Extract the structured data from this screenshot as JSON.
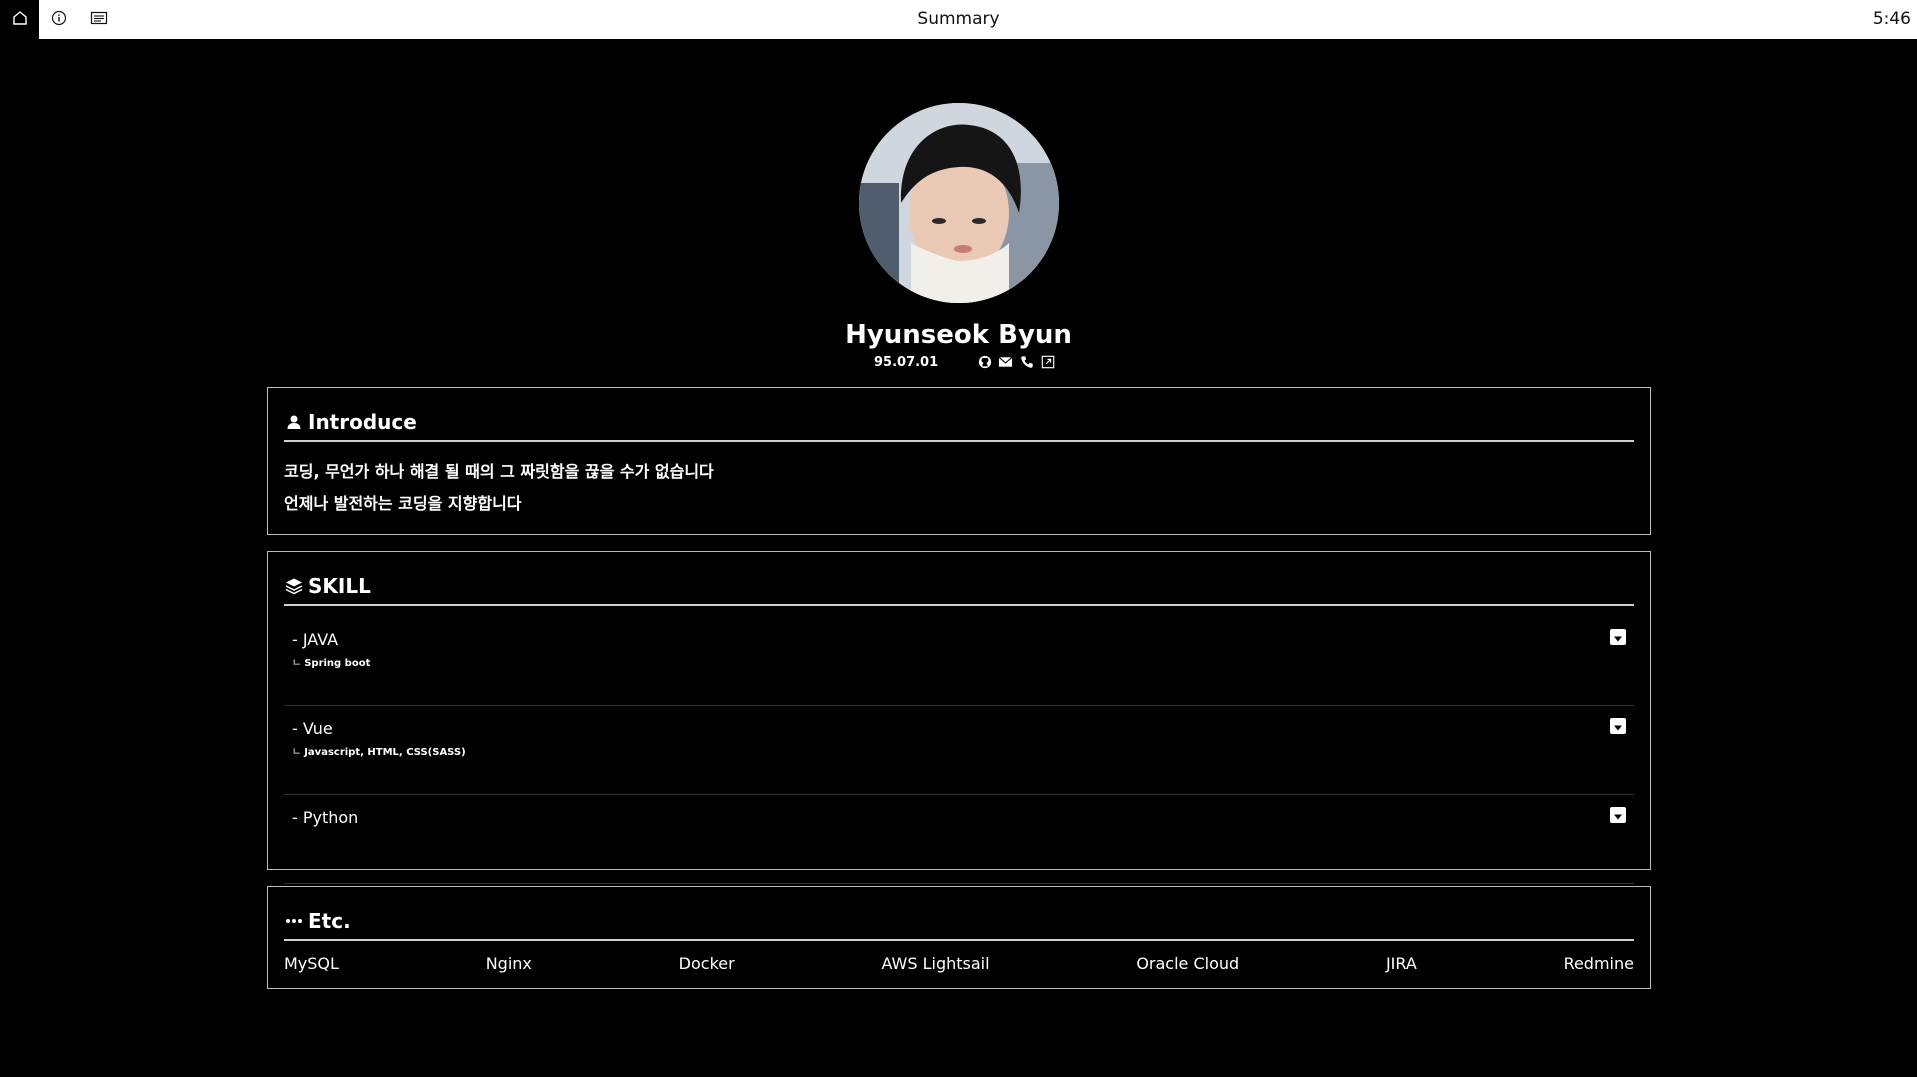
{
  "topbar": {
    "title": "Summary",
    "clock": "5:46",
    "icons": [
      "home-icon",
      "info-icon",
      "reader-icon"
    ]
  },
  "profile": {
    "name": "Hyunseok Byun",
    "birth": "95.07.01",
    "contact_icons": [
      "github-icon",
      "mail-icon",
      "phone-icon",
      "external-link-icon"
    ]
  },
  "introduce": {
    "title": "Introduce",
    "lines": [
      "코딩, 무언가 하나 해결 될 때의 그 짜릿함을 끊을 수가 없습니다",
      "언제나 발전하는 코딩을 지향합니다"
    ]
  },
  "skill": {
    "title": "SKILL",
    "items": [
      {
        "name": "- JAVA",
        "sub": "Spring boot"
      },
      {
        "name": "- Vue",
        "sub": "Javascript, HTML, CSS(SASS)"
      },
      {
        "name": "- Python",
        "sub": ""
      }
    ],
    "sub_prefix": "ㄴ"
  },
  "etc": {
    "title": "Etc.",
    "items": [
      "MySQL",
      "Nginx",
      "Docker",
      "AWS Lightsail",
      "Oracle Cloud",
      "JIRA",
      "Redmine"
    ]
  },
  "colors": {
    "background": "#000000",
    "text": "#ffffff",
    "border": "#bdbdbd",
    "topbar": "#ffffff"
  }
}
